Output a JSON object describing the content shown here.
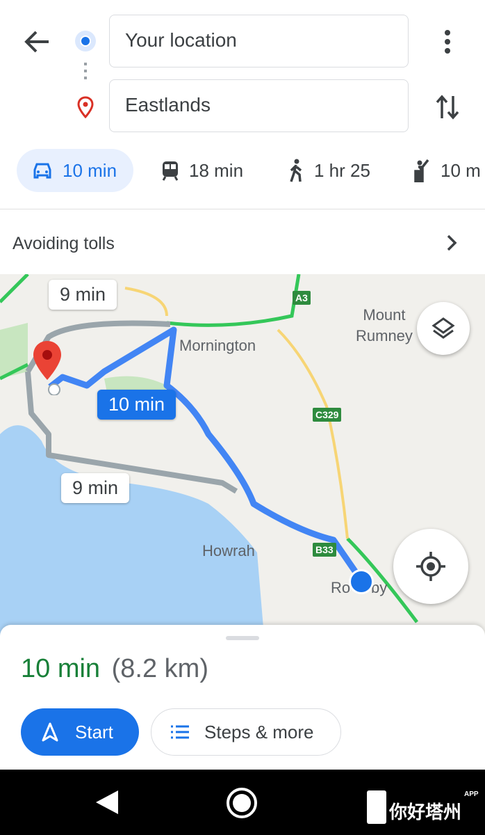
{
  "search": {
    "origin": "Your location",
    "destination": "Eastlands"
  },
  "modes": [
    {
      "icon": "car-icon",
      "label": "10 min",
      "selected": true
    },
    {
      "icon": "train-icon",
      "label": "18 min"
    },
    {
      "icon": "walk-icon",
      "label": "1 hr 25"
    },
    {
      "icon": "ride-hail-icon",
      "label": "10 m"
    }
  ],
  "options": {
    "label": "Avoiding tolls"
  },
  "map": {
    "route_labels": [
      "9 min",
      "10 min",
      "9 min"
    ],
    "places": [
      "Mornington",
      "Mount\nRumney",
      "Howrah",
      "Ro",
      "by"
    ],
    "road_shields": [
      "A3",
      "C329",
      "B33"
    ],
    "colors": {
      "route_selected": "#4285f4",
      "route_alt": "#9aa5ab",
      "water": "#a8d1f5",
      "park": "#c8e6c0",
      "major_road": "#34c759",
      "road": "#f7d575"
    }
  },
  "summary": {
    "time": "10 min",
    "distance": "(8.2 km)",
    "time_color": "#188038"
  },
  "actions": {
    "start": "Start",
    "steps": "Steps & more"
  },
  "watermark": {
    "text": "你好塔州",
    "sup": "APP"
  }
}
